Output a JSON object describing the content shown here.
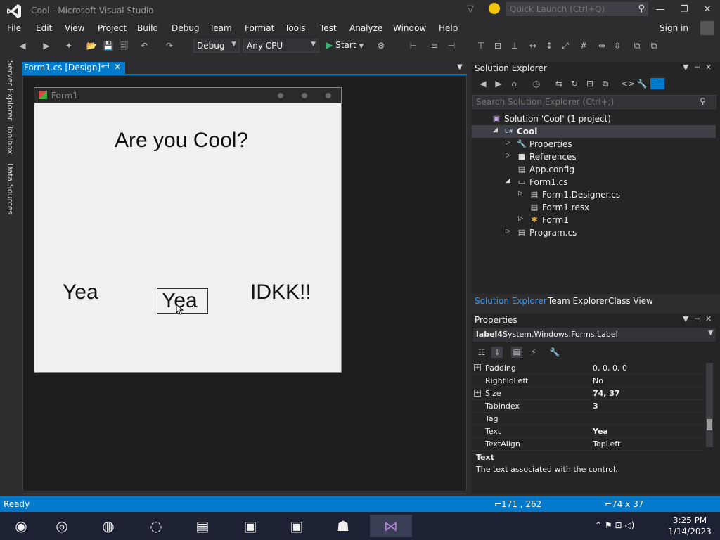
{
  "window": {
    "title": "Cool - Microsoft Visual Studio",
    "quick_launch_placeholder": "Quick Launch (Ctrl+Q)",
    "minimize": "—",
    "maximize": "❐",
    "close": "✕"
  },
  "menu": {
    "items": [
      "File",
      "Edit",
      "View",
      "Project",
      "Build",
      "Debug",
      "Team",
      "Format",
      "Tools",
      "Test",
      "Analyze",
      "Window",
      "Help"
    ],
    "signin": "Sign in"
  },
  "toolbar": {
    "config": "Debug",
    "platform": "Any CPU",
    "start": "Start"
  },
  "left_tabs": [
    "Server Explorer",
    "Toolbox",
    "Data Sources"
  ],
  "document": {
    "tab_label": "Form1.cs [Design]*",
    "form_title": "Form1",
    "heading": "Are you Cool?",
    "label_yea_1": "Yea",
    "label_yea_2": "Yea",
    "label_idkk": "IDKK!!"
  },
  "solution_explorer": {
    "title": "Solution Explorer",
    "search_placeholder": "Search Solution Explorer (Ctrl+;)",
    "tree": [
      {
        "label": "Solution 'Cool' (1 project)",
        "icon": "solution-icon",
        "arrow": ""
      },
      {
        "label": "Cool",
        "icon": "csharp-project-icon",
        "arrow": "◢"
      },
      {
        "label": "Properties",
        "icon": "wrench-icon",
        "arrow": "▷"
      },
      {
        "label": "References",
        "icon": "references-icon",
        "arrow": "▷"
      },
      {
        "label": "App.config",
        "icon": "config-file-icon",
        "arrow": ""
      },
      {
        "label": "Form1.cs",
        "icon": "form-file-icon",
        "arrow": "◢"
      },
      {
        "label": "Form1.Designer.cs",
        "icon": "cs-file-icon",
        "arrow": "▷"
      },
      {
        "label": "Form1.resx",
        "icon": "resx-file-icon",
        "arrow": ""
      },
      {
        "label": "Form1",
        "icon": "class-icon",
        "arrow": "▷"
      },
      {
        "label": "Program.cs",
        "icon": "cs-file-icon",
        "arrow": "▷"
      }
    ],
    "tabs": [
      "Solution Explorer",
      "Team Explorer",
      "Class View"
    ]
  },
  "properties": {
    "title": "Properties",
    "object_name": "label4",
    "object_type": "System.Windows.Forms.Label",
    "rows": [
      {
        "name": "Padding",
        "value": "0, 0, 0, 0",
        "expandable": true,
        "bold": false
      },
      {
        "name": "RightToLeft",
        "value": "No",
        "expandable": false,
        "bold": false
      },
      {
        "name": "Size",
        "value": "74, 37",
        "expandable": true,
        "bold": true
      },
      {
        "name": "TabIndex",
        "value": "3",
        "expandable": false,
        "bold": true
      },
      {
        "name": "Tag",
        "value": "",
        "expandable": false,
        "bold": false
      },
      {
        "name": "Text",
        "value": "Yea",
        "expandable": false,
        "bold": true
      },
      {
        "name": "TextAlign",
        "value": "TopLeft",
        "expandable": false,
        "bold": false
      }
    ],
    "desc_title": "Text",
    "desc_text": "The text associated with the control."
  },
  "status": {
    "text": "Ready",
    "position": "171 , 262",
    "size": "74 x 37"
  },
  "taskbar": {
    "time": "3:25 PM",
    "date": "1/14/2023"
  },
  "colors": {
    "accent": "#007acc",
    "ide_background": "#2d2d30",
    "designer_background": "#1e1e1e",
    "form_background": "#f0f0f0"
  }
}
